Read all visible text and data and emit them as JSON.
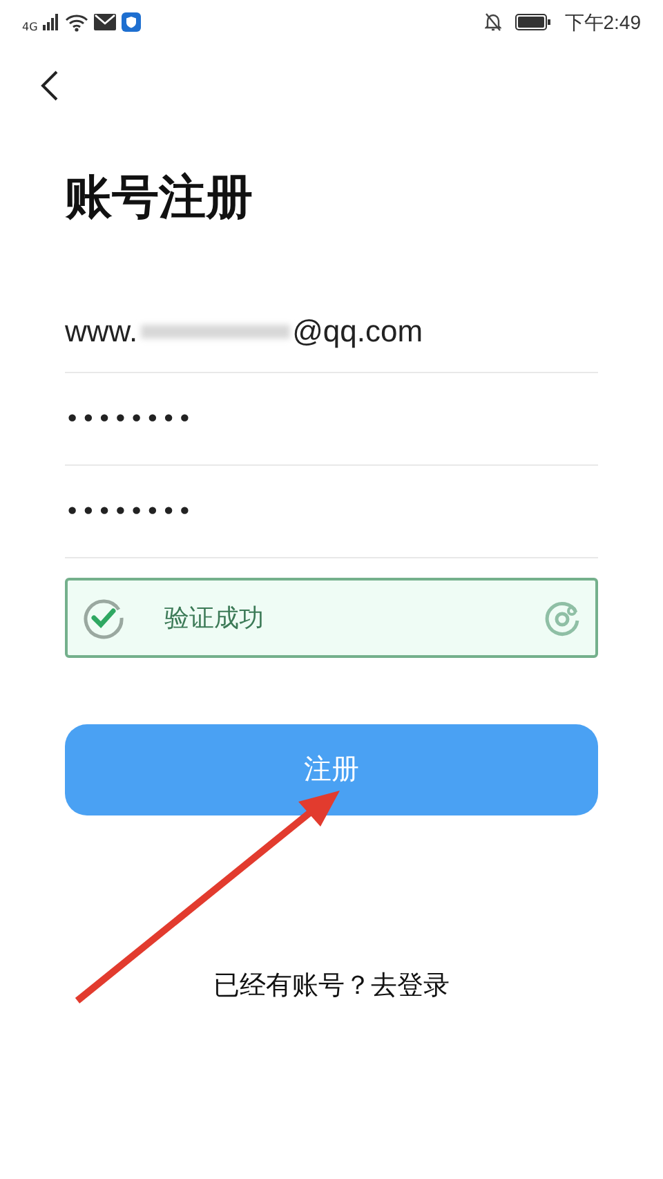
{
  "status_bar": {
    "network": "4G",
    "time": "下午2:49"
  },
  "title": "账号注册",
  "email_field": {
    "value_start": "www.",
    "redacted": true,
    "value_end": "@qq.com"
  },
  "password_fields": [
    {
      "value": "••••••••"
    },
    {
      "value": "••••••••"
    }
  ],
  "captcha": {
    "verified": true,
    "label": "验证成功"
  },
  "register_button": {
    "label": "注册"
  },
  "login_link": {
    "label": "已经有账号？去登录"
  }
}
